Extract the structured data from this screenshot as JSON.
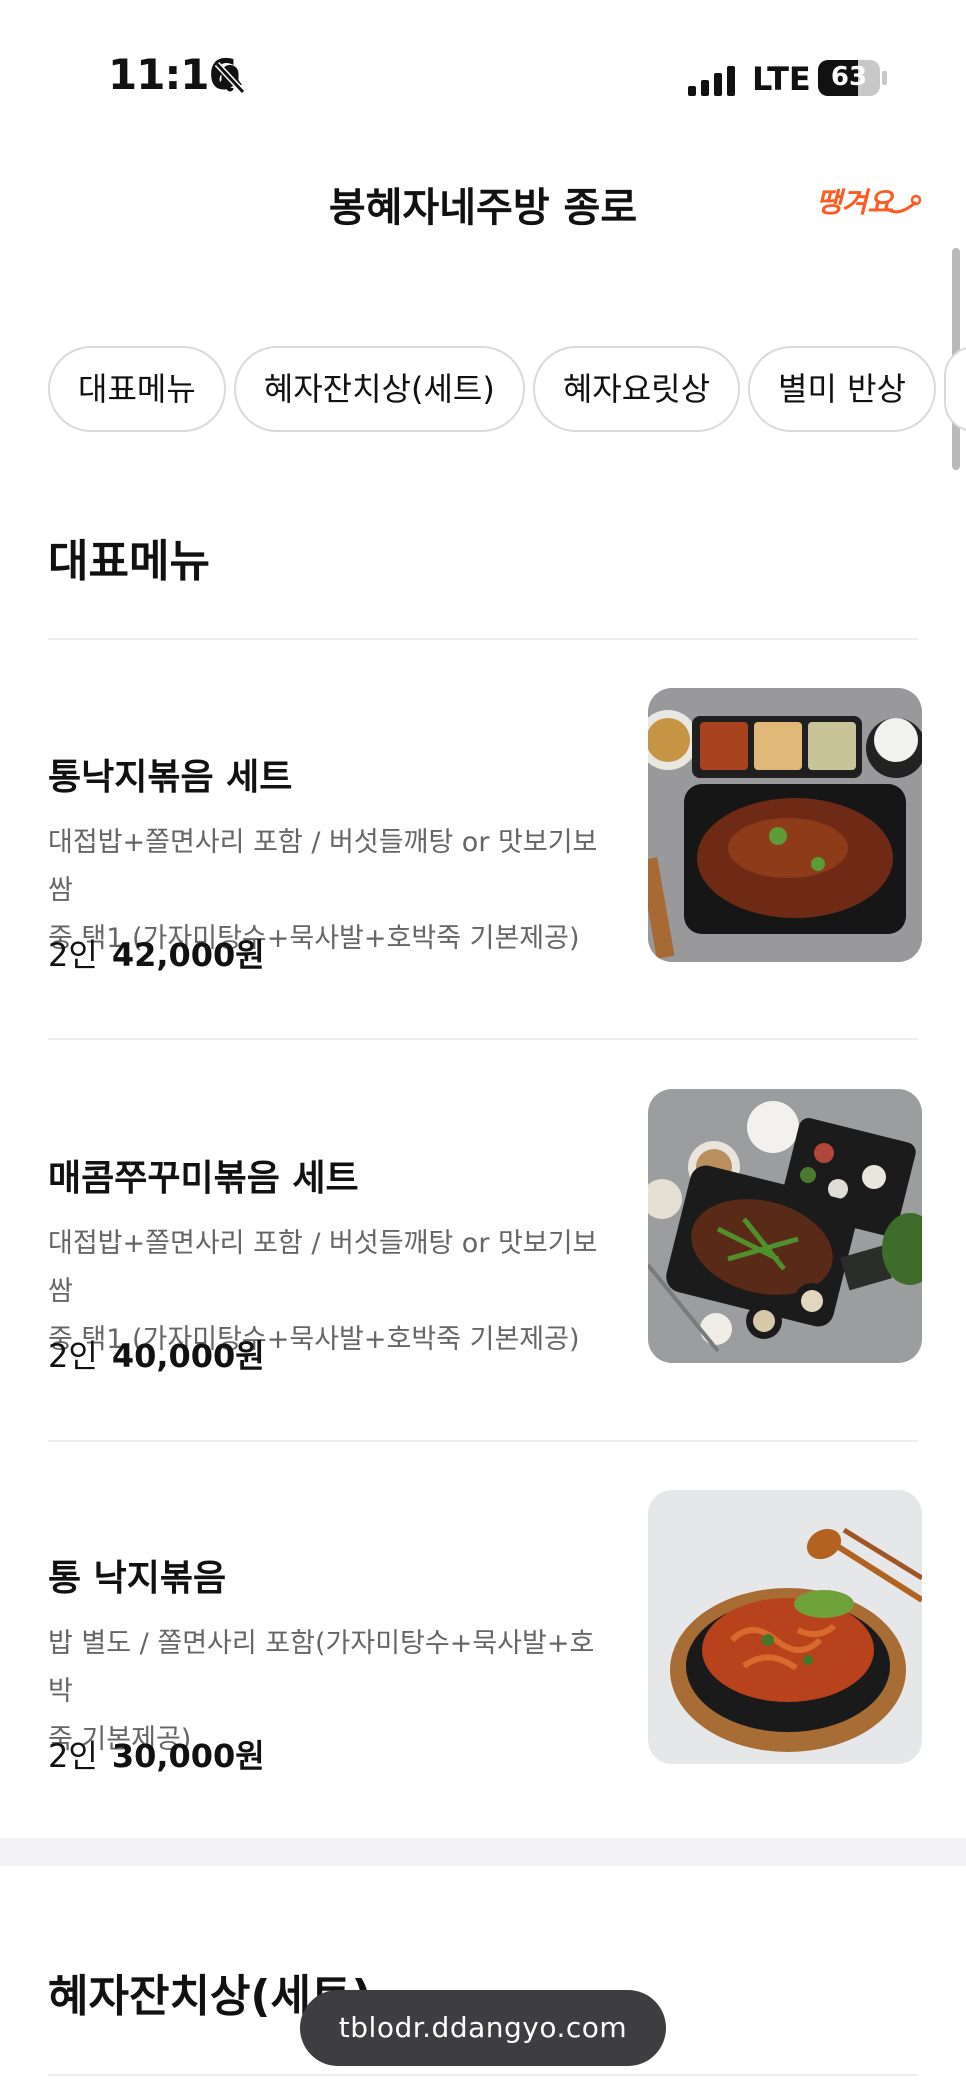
{
  "status_bar": {
    "time": "11:16",
    "network": "LTE",
    "battery": "63"
  },
  "header": {
    "title": "봉혜자네주방 종로",
    "brand_logo_text": "땡겨요"
  },
  "tabs": [
    "대표메뉴",
    "혜자잔치상(세트)",
    "혜자요릿상",
    "별미 반상"
  ],
  "sections": [
    {
      "title": "대표메뉴",
      "items": [
        {
          "name": "통낙지볶음 세트",
          "desc_line1": "대접밥+쫄면사리 포함 / 버섯들깨탕 or 맛보기보쌈",
          "desc_line2": "중 택1 (가자미탕수+묵사발+호박죽 기본제공)",
          "qty": "2인",
          "price": "42,000원",
          "image": "octopus-stirfry-set-photo"
        },
        {
          "name": "매콤쭈꾸미볶음 세트",
          "desc_line1": "대접밥+쫄면사리 포함 / 버섯들깨탕 or 맛보기보쌈",
          "desc_line2": "중 택1 (가자미탕수+묵사발+호박죽 기본제공)",
          "qty": "2인",
          "price": "40,000원",
          "image": "spicy-webfoot-octopus-set-photo"
        },
        {
          "name": "통 낙지볶음",
          "desc_line1": "밥 별도 / 쫄면사리 포함(가자미탕수+묵사발+호박",
          "desc_line2": "죽 기본제공)",
          "qty": "2인",
          "price": "30,000원",
          "image": "octopus-stirfry-bowl-photo"
        }
      ]
    },
    {
      "title": "혜자잔치상(세트)"
    }
  ],
  "url_pill": "tblodr.ddangyo.com",
  "colors": {
    "brand": "#ff5a1f",
    "divider": "#eeeef0",
    "desc_text": "#666666",
    "band": "#f4f4f8"
  }
}
